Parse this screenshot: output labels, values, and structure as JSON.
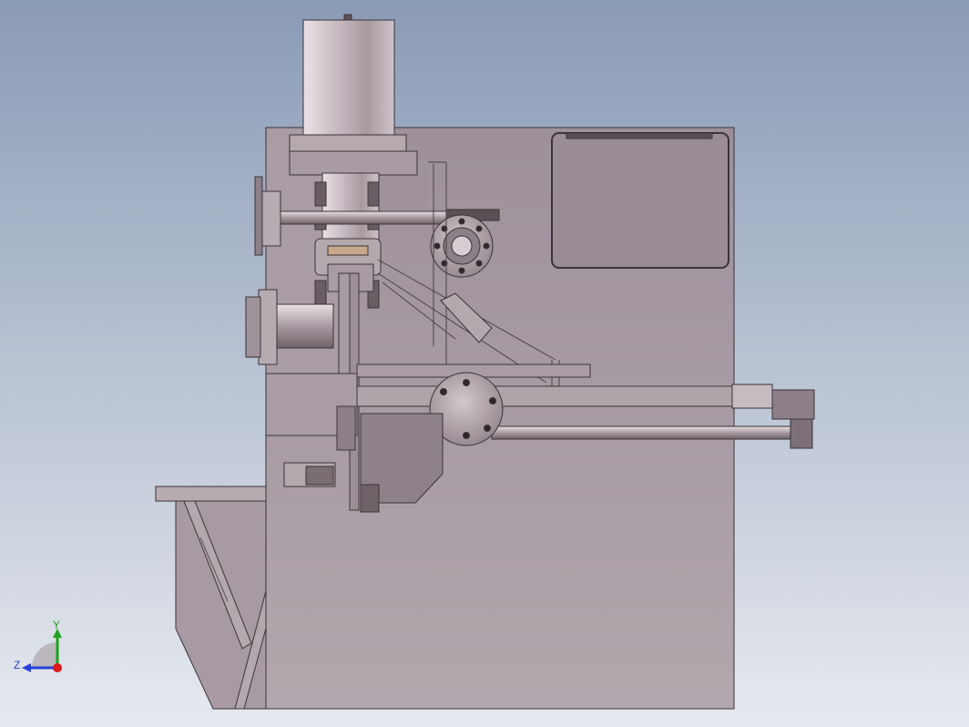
{
  "viewport": {
    "background_top": "#8a9bb6",
    "background_bottom": "#e6e9ef"
  },
  "model": {
    "body_color": "#ab9da7",
    "edge_color": "#3b3438",
    "steel_color": "#b8adb4",
    "dark_color": "#5a4f55",
    "accent_wood": "#c8a78a"
  },
  "triad": {
    "y_label": "Y",
    "z_label": "Z",
    "y_color": "#1aa31a",
    "z_color": "#2a3fd6",
    "x_color": "#e01818"
  }
}
